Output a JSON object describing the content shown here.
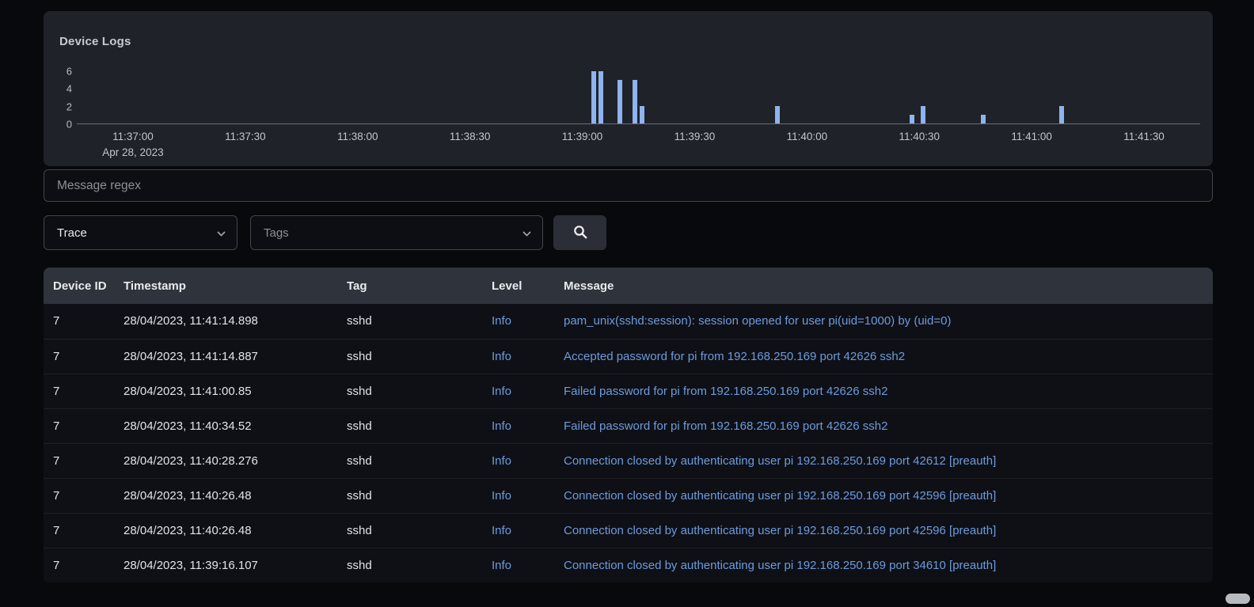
{
  "chart": {
    "title": "Device Logs"
  },
  "chart_data": {
    "type": "bar",
    "title": "Device Logs",
    "xlabel": "",
    "ylabel": "",
    "x_start": "11:36:45",
    "x_end": "11:41:45",
    "x_date": "Apr 28, 2023",
    "x_ticks": [
      "11:37:00",
      "11:37:30",
      "11:38:00",
      "11:38:30",
      "11:39:00",
      "11:39:30",
      "11:40:00",
      "11:40:30",
      "11:41:00",
      "11:41:30"
    ],
    "y_ticks": [
      0,
      2,
      4,
      6
    ],
    "ylim": [
      0,
      7
    ],
    "grid": false,
    "legend": "none",
    "bars": [
      {
        "time": "11:39:03",
        "count": 6
      },
      {
        "time": "11:39:05",
        "count": 6
      },
      {
        "time": "11:39:10",
        "count": 5
      },
      {
        "time": "11:39:14",
        "count": 5
      },
      {
        "time": "11:39:16",
        "count": 2
      },
      {
        "time": "11:39:52",
        "count": 2
      },
      {
        "time": "11:40:28",
        "count": 1
      },
      {
        "time": "11:40:31",
        "count": 2
      },
      {
        "time": "11:40:47",
        "count": 1
      },
      {
        "time": "11:41:08",
        "count": 2
      }
    ]
  },
  "filters": {
    "regex_placeholder": "Message regex",
    "level_select": {
      "value": "Trace"
    },
    "tags_select": {
      "placeholder": "Tags"
    },
    "search_icon": "magnifier-icon"
  },
  "table": {
    "columns": [
      "Device ID",
      "Timestamp",
      "Tag",
      "Level",
      "Message"
    ],
    "rows": [
      {
        "device_id": "7",
        "timestamp": "28/04/2023, 11:41:14.898",
        "tag": "sshd",
        "level": "Info",
        "message": "pam_unix(sshd:session): session opened for user pi(uid=1000) by (uid=0)"
      },
      {
        "device_id": "7",
        "timestamp": "28/04/2023, 11:41:14.887",
        "tag": "sshd",
        "level": "Info",
        "message": "Accepted password for pi from 192.168.250.169 port 42626 ssh2"
      },
      {
        "device_id": "7",
        "timestamp": "28/04/2023, 11:41:00.85",
        "tag": "sshd",
        "level": "Info",
        "message": "Failed password for pi from 192.168.250.169 port 42626 ssh2"
      },
      {
        "device_id": "7",
        "timestamp": "28/04/2023, 11:40:34.52",
        "tag": "sshd",
        "level": "Info",
        "message": "Failed password for pi from 192.168.250.169 port 42626 ssh2"
      },
      {
        "device_id": "7",
        "timestamp": "28/04/2023, 11:40:28.276",
        "tag": "sshd",
        "level": "Info",
        "message": "Connection closed by authenticating user pi 192.168.250.169 port 42612 [preauth]"
      },
      {
        "device_id": "7",
        "timestamp": "28/04/2023, 11:40:26.48",
        "tag": "sshd",
        "level": "Info",
        "message": "Connection closed by authenticating user pi 192.168.250.169 port 42596 [preauth]"
      },
      {
        "device_id": "7",
        "timestamp": "28/04/2023, 11:40:26.48",
        "tag": "sshd",
        "level": "Info",
        "message": "Connection closed by authenticating user pi 192.168.250.169 port 42596 [preauth]"
      },
      {
        "device_id": "7",
        "timestamp": "28/04/2023, 11:39:16.107",
        "tag": "sshd",
        "level": "Info",
        "message": "Connection closed by authenticating user pi 192.168.250.169 port 34610 [preauth]"
      }
    ]
  },
  "theme": {
    "bar_color": "#8fb3ee",
    "link_blue": "#6d9bdd",
    "panel_bg": "#1f2229",
    "header_bg": "#2f333c",
    "row_bg": "#0e1016",
    "page_bg": "#08090d"
  }
}
